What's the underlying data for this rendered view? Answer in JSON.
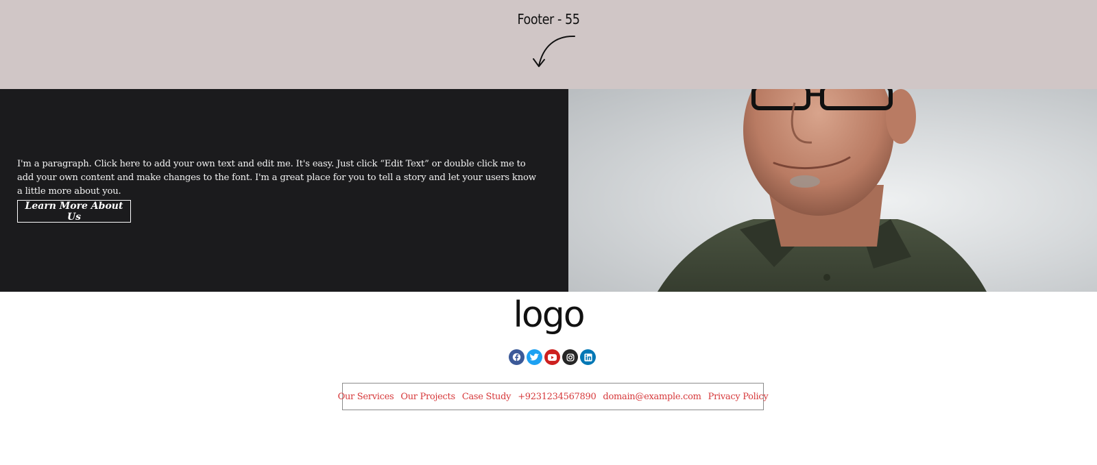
{
  "banner": {
    "title": "Footer - 55",
    "background_color": "#d0c6c6",
    "arrow_icon": "curved-arrow-down-left-icon"
  },
  "hero": {
    "background_color": "#1b1b1d",
    "paragraph": "I'm a paragraph. Click here to add your own text and edit me. It's easy. Just click “Edit Text” or double click me to add your own content and make changes to the font. I'm a great place for you to tell a story and let your users know a little more about you.",
    "button_label": "Learn More About Us",
    "image_subject": "smiling man in olive polo shirt with glasses"
  },
  "footer": {
    "logo_text": "logo",
    "socials": [
      {
        "name": "facebook",
        "icon": "facebook-icon",
        "color": "#3b5998"
      },
      {
        "name": "twitter",
        "icon": "twitter-icon",
        "color": "#1da1f2"
      },
      {
        "name": "youtube",
        "icon": "youtube-icon",
        "color": "#cd201f"
      },
      {
        "name": "instagram",
        "icon": "instagram-icon",
        "color": "#262626"
      },
      {
        "name": "linkedin",
        "icon": "linkedin-icon",
        "color": "#0077b5"
      }
    ],
    "links": [
      "Our Services",
      "Our Projects",
      "Case Study",
      "+9231234567890",
      "domain@example.com",
      "Privacy Policy"
    ],
    "link_color": "#d6383a"
  }
}
